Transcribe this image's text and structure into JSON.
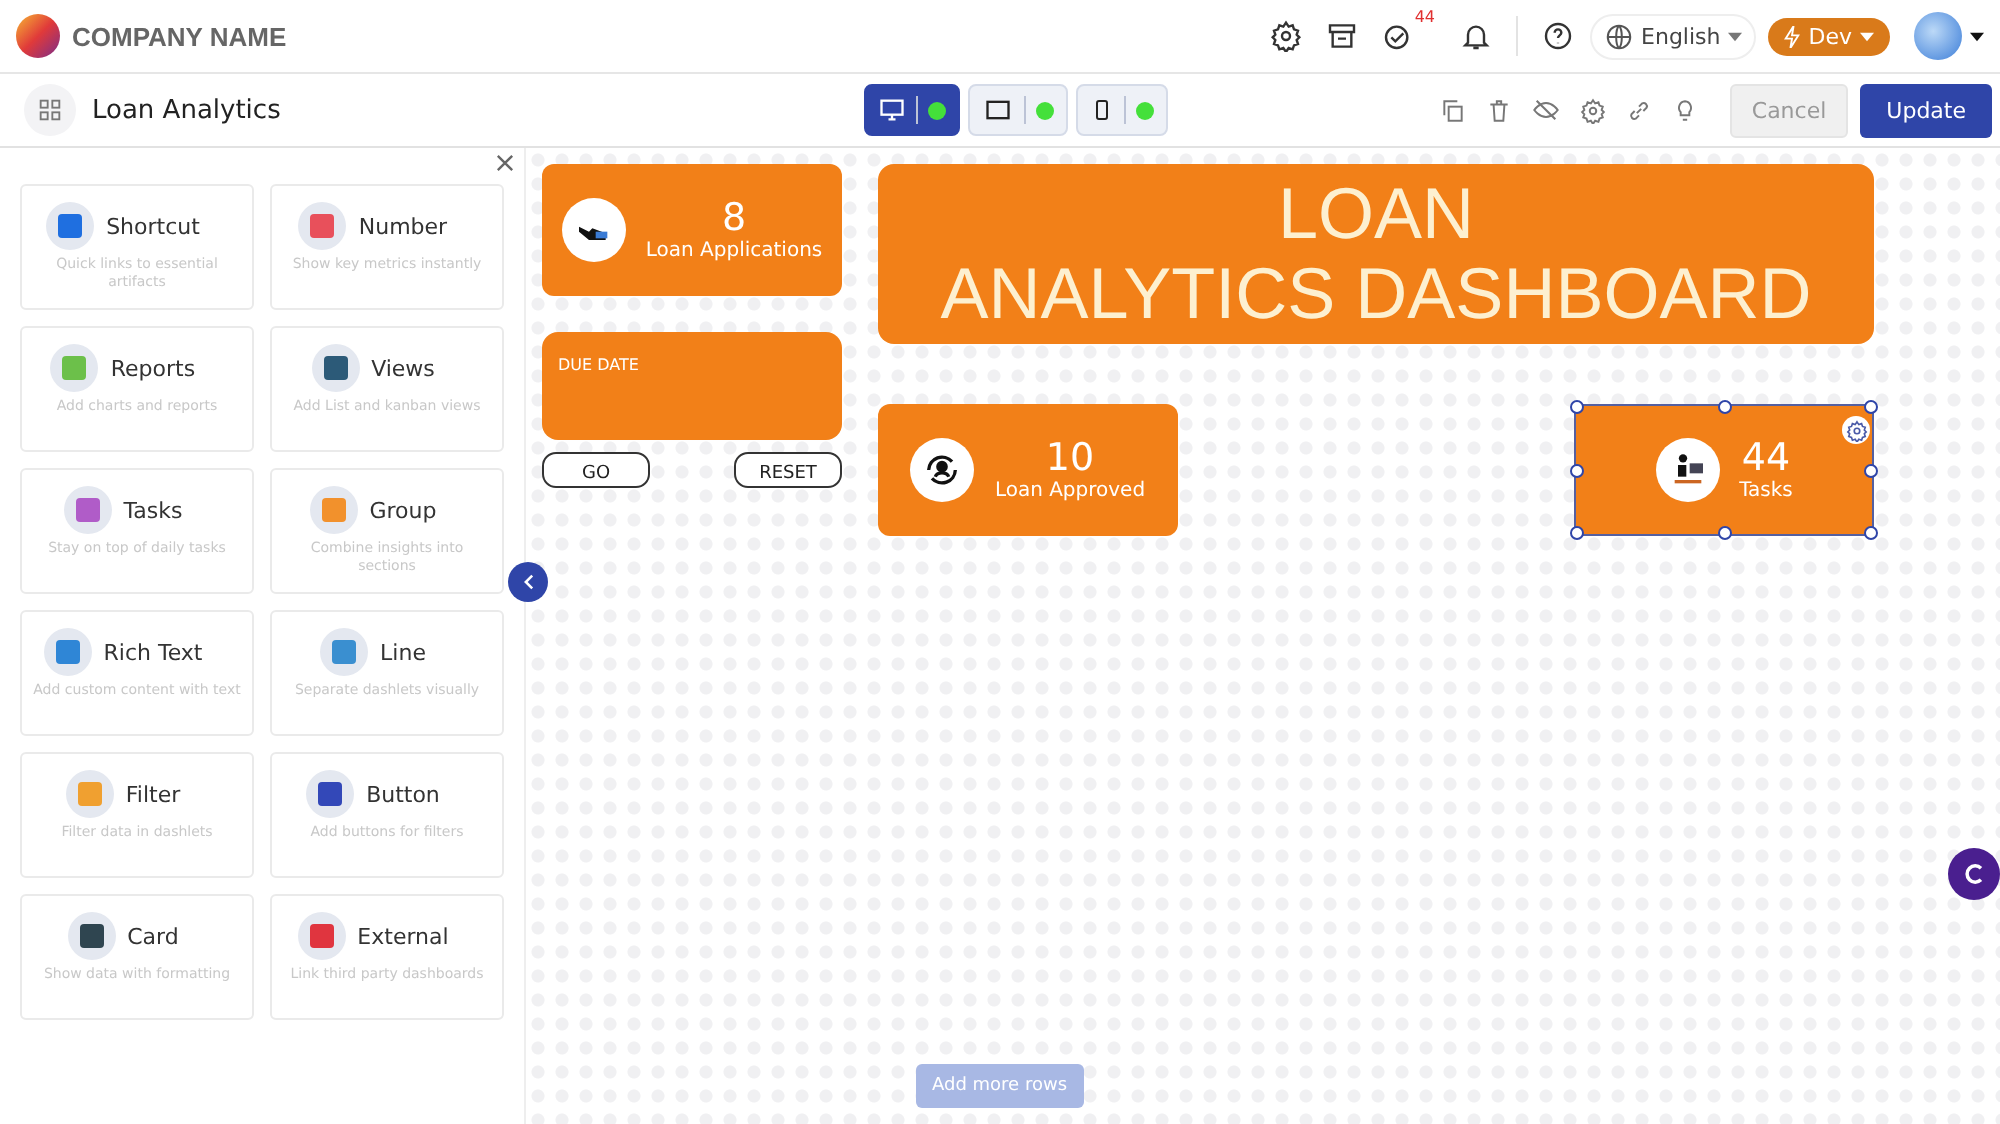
{
  "header": {
    "company": "COMPANY NAME",
    "tasks_badge": "44",
    "language": "English",
    "environment": "Dev"
  },
  "toolbar": {
    "title": "Loan Analytics",
    "devices": [
      {
        "kind": "desktop",
        "selected": true,
        "on": true
      },
      {
        "kind": "tablet",
        "selected": false,
        "on": true
      },
      {
        "kind": "mobile",
        "selected": false,
        "on": true
      }
    ],
    "cancel": "Cancel",
    "update": "Update"
  },
  "palette": {
    "items": [
      {
        "title": "Shortcut",
        "description": "Quick links to essential artifacts",
        "color": "#1f6fe0"
      },
      {
        "title": "Number",
        "description": "Show key metrics instantly",
        "color": "#e8505b"
      },
      {
        "title": "Reports",
        "description": "Add charts and reports",
        "color": "#6cc04a"
      },
      {
        "title": "Views",
        "description": "Add List and kanban views",
        "color": "#2c5a78"
      },
      {
        "title": "Tasks",
        "description": "Stay on top of daily tasks",
        "color": "#b05cc8"
      },
      {
        "title": "Group",
        "description": "Combine insights into sections",
        "color": "#f2912c"
      },
      {
        "title": "Rich Text",
        "description": "Add custom content with text",
        "color": "#2f86d6"
      },
      {
        "title": "Line",
        "description": "Separate dashlets visually",
        "color": "#3a8fd0"
      },
      {
        "title": "Filter",
        "description": "Filter data in dashlets",
        "color": "#f0a030"
      },
      {
        "title": "Button",
        "description": "Add buttons for filters",
        "color": "#3348b8"
      },
      {
        "title": "Card",
        "description": "Show data with formatting",
        "color": "#2f4550"
      },
      {
        "title": "External",
        "description": "Link third party dashboards",
        "color": "#e0353f"
      }
    ]
  },
  "canvas": {
    "widgets": [
      {
        "kind": "kpi",
        "value": "8",
        "label": "Loan Applications",
        "selected": false
      },
      {
        "kind": "title",
        "text": "LOAN\nANALYTICS DASHBOARD"
      },
      {
        "kind": "filter",
        "label": "DUE DATE"
      },
      {
        "kind": "buttons",
        "buttons": [
          "GO",
          "RESET"
        ]
      },
      {
        "kind": "kpi",
        "value": "10",
        "label": "Loan Approved",
        "selected": false
      },
      {
        "kind": "kpi",
        "value": "44",
        "label": "Tasks",
        "selected": true
      }
    ],
    "add_rows": "Add more rows"
  }
}
